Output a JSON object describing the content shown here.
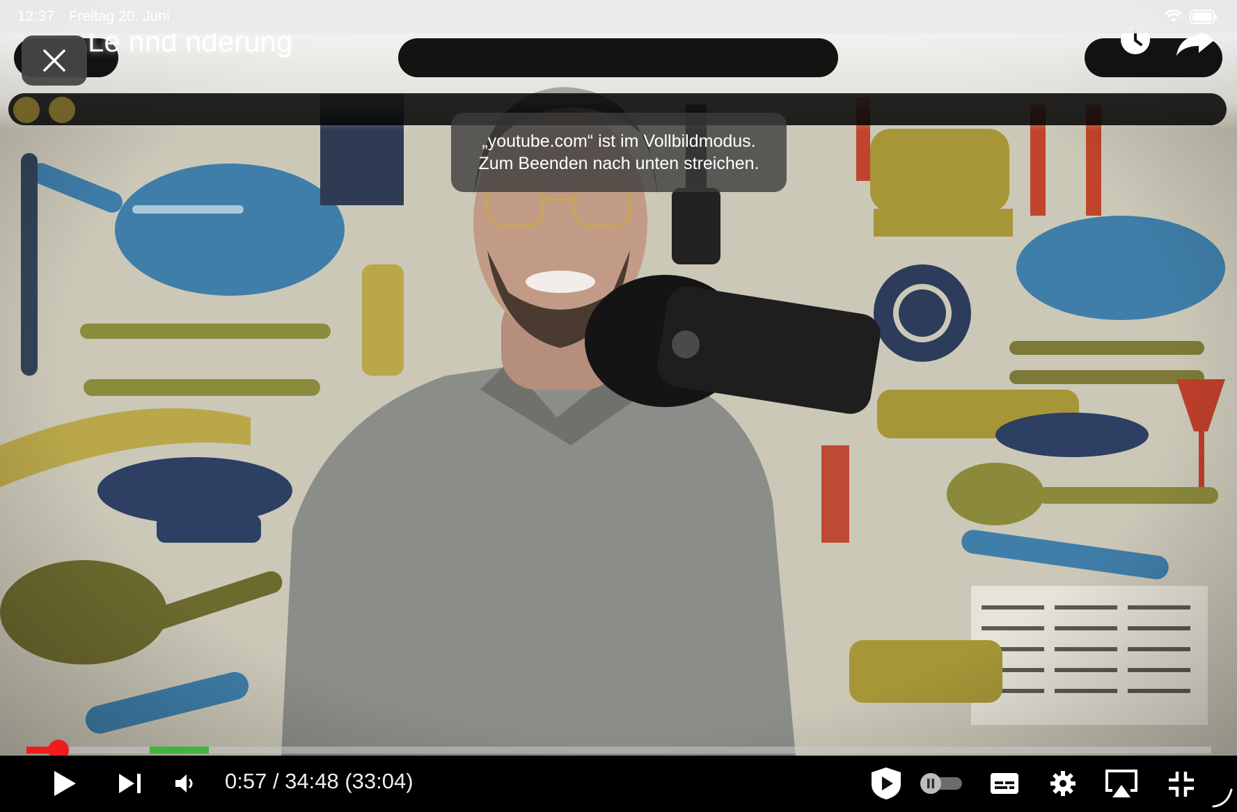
{
  "status_bar": {
    "time": "12:37",
    "date": "Freitag 20. Juni"
  },
  "top_overlay": {
    "title": "Le      nnd         nderung"
  },
  "toast": {
    "line1": "„youtube.com“ ist im Vollbildmodus.",
    "line2": "Zum Beenden nach unten streichen."
  },
  "player": {
    "time_display": "0:57 / 34:48 (33:04)",
    "progress_fraction": 0.027,
    "buffer_start_fraction": 0.104,
    "buffer_end_fraction": 0.154
  },
  "colors": {
    "progress": "#ee1c1c",
    "buffer": "#3fb43f",
    "controls_bg": "#000000",
    "toast_bg": "#3c3c3c"
  },
  "icons": {
    "close": "close-icon",
    "clock": "clock-icon",
    "share": "share-icon",
    "play": "play-icon",
    "next": "next-icon",
    "volume": "volume-icon",
    "shield": "shield-play-icon",
    "autoplay": "autoplay-toggle-icon",
    "subtitles": "subtitles-icon",
    "settings": "gear-icon",
    "airplay": "airplay-icon",
    "exit_fullscreen": "exit-fullscreen-icon"
  }
}
